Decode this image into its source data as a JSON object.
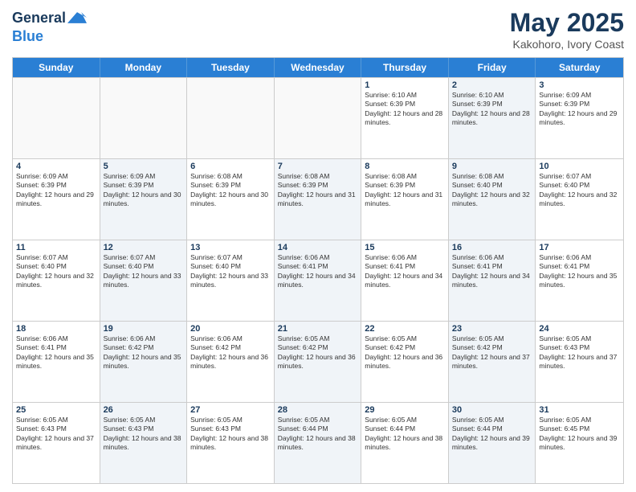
{
  "header": {
    "logo_line1": "General",
    "logo_line2": "Blue",
    "month_title": "May 2025",
    "location": "Kakohoro, Ivory Coast"
  },
  "days_of_week": [
    "Sunday",
    "Monday",
    "Tuesday",
    "Wednesday",
    "Thursday",
    "Friday",
    "Saturday"
  ],
  "rows": [
    [
      {
        "day": "",
        "text": "",
        "shaded": false,
        "empty": true
      },
      {
        "day": "",
        "text": "",
        "shaded": false,
        "empty": true
      },
      {
        "day": "",
        "text": "",
        "shaded": false,
        "empty": true
      },
      {
        "day": "",
        "text": "",
        "shaded": false,
        "empty": true
      },
      {
        "day": "1",
        "text": "Sunrise: 6:10 AM\nSunset: 6:39 PM\nDaylight: 12 hours and 28 minutes.",
        "shaded": false,
        "empty": false
      },
      {
        "day": "2",
        "text": "Sunrise: 6:10 AM\nSunset: 6:39 PM\nDaylight: 12 hours and 28 minutes.",
        "shaded": true,
        "empty": false
      },
      {
        "day": "3",
        "text": "Sunrise: 6:09 AM\nSunset: 6:39 PM\nDaylight: 12 hours and 29 minutes.",
        "shaded": false,
        "empty": false
      }
    ],
    [
      {
        "day": "4",
        "text": "Sunrise: 6:09 AM\nSunset: 6:39 PM\nDaylight: 12 hours and 29 minutes.",
        "shaded": false,
        "empty": false
      },
      {
        "day": "5",
        "text": "Sunrise: 6:09 AM\nSunset: 6:39 PM\nDaylight: 12 hours and 30 minutes.",
        "shaded": true,
        "empty": false
      },
      {
        "day": "6",
        "text": "Sunrise: 6:08 AM\nSunset: 6:39 PM\nDaylight: 12 hours and 30 minutes.",
        "shaded": false,
        "empty": false
      },
      {
        "day": "7",
        "text": "Sunrise: 6:08 AM\nSunset: 6:39 PM\nDaylight: 12 hours and 31 minutes.",
        "shaded": true,
        "empty": false
      },
      {
        "day": "8",
        "text": "Sunrise: 6:08 AM\nSunset: 6:39 PM\nDaylight: 12 hours and 31 minutes.",
        "shaded": false,
        "empty": false
      },
      {
        "day": "9",
        "text": "Sunrise: 6:08 AM\nSunset: 6:40 PM\nDaylight: 12 hours and 32 minutes.",
        "shaded": true,
        "empty": false
      },
      {
        "day": "10",
        "text": "Sunrise: 6:07 AM\nSunset: 6:40 PM\nDaylight: 12 hours and 32 minutes.",
        "shaded": false,
        "empty": false
      }
    ],
    [
      {
        "day": "11",
        "text": "Sunrise: 6:07 AM\nSunset: 6:40 PM\nDaylight: 12 hours and 32 minutes.",
        "shaded": false,
        "empty": false
      },
      {
        "day": "12",
        "text": "Sunrise: 6:07 AM\nSunset: 6:40 PM\nDaylight: 12 hours and 33 minutes.",
        "shaded": true,
        "empty": false
      },
      {
        "day": "13",
        "text": "Sunrise: 6:07 AM\nSunset: 6:40 PM\nDaylight: 12 hours and 33 minutes.",
        "shaded": false,
        "empty": false
      },
      {
        "day": "14",
        "text": "Sunrise: 6:06 AM\nSunset: 6:41 PM\nDaylight: 12 hours and 34 minutes.",
        "shaded": true,
        "empty": false
      },
      {
        "day": "15",
        "text": "Sunrise: 6:06 AM\nSunset: 6:41 PM\nDaylight: 12 hours and 34 minutes.",
        "shaded": false,
        "empty": false
      },
      {
        "day": "16",
        "text": "Sunrise: 6:06 AM\nSunset: 6:41 PM\nDaylight: 12 hours and 34 minutes.",
        "shaded": true,
        "empty": false
      },
      {
        "day": "17",
        "text": "Sunrise: 6:06 AM\nSunset: 6:41 PM\nDaylight: 12 hours and 35 minutes.",
        "shaded": false,
        "empty": false
      }
    ],
    [
      {
        "day": "18",
        "text": "Sunrise: 6:06 AM\nSunset: 6:41 PM\nDaylight: 12 hours and 35 minutes.",
        "shaded": false,
        "empty": false
      },
      {
        "day": "19",
        "text": "Sunrise: 6:06 AM\nSunset: 6:42 PM\nDaylight: 12 hours and 35 minutes.",
        "shaded": true,
        "empty": false
      },
      {
        "day": "20",
        "text": "Sunrise: 6:06 AM\nSunset: 6:42 PM\nDaylight: 12 hours and 36 minutes.",
        "shaded": false,
        "empty": false
      },
      {
        "day": "21",
        "text": "Sunrise: 6:05 AM\nSunset: 6:42 PM\nDaylight: 12 hours and 36 minutes.",
        "shaded": true,
        "empty": false
      },
      {
        "day": "22",
        "text": "Sunrise: 6:05 AM\nSunset: 6:42 PM\nDaylight: 12 hours and 36 minutes.",
        "shaded": false,
        "empty": false
      },
      {
        "day": "23",
        "text": "Sunrise: 6:05 AM\nSunset: 6:42 PM\nDaylight: 12 hours and 37 minutes.",
        "shaded": true,
        "empty": false
      },
      {
        "day": "24",
        "text": "Sunrise: 6:05 AM\nSunset: 6:43 PM\nDaylight: 12 hours and 37 minutes.",
        "shaded": false,
        "empty": false
      }
    ],
    [
      {
        "day": "25",
        "text": "Sunrise: 6:05 AM\nSunset: 6:43 PM\nDaylight: 12 hours and 37 minutes.",
        "shaded": false,
        "empty": false
      },
      {
        "day": "26",
        "text": "Sunrise: 6:05 AM\nSunset: 6:43 PM\nDaylight: 12 hours and 38 minutes.",
        "shaded": true,
        "empty": false
      },
      {
        "day": "27",
        "text": "Sunrise: 6:05 AM\nSunset: 6:43 PM\nDaylight: 12 hours and 38 minutes.",
        "shaded": false,
        "empty": false
      },
      {
        "day": "28",
        "text": "Sunrise: 6:05 AM\nSunset: 6:44 PM\nDaylight: 12 hours and 38 minutes.",
        "shaded": true,
        "empty": false
      },
      {
        "day": "29",
        "text": "Sunrise: 6:05 AM\nSunset: 6:44 PM\nDaylight: 12 hours and 38 minutes.",
        "shaded": false,
        "empty": false
      },
      {
        "day": "30",
        "text": "Sunrise: 6:05 AM\nSunset: 6:44 PM\nDaylight: 12 hours and 39 minutes.",
        "shaded": true,
        "empty": false
      },
      {
        "day": "31",
        "text": "Sunrise: 6:05 AM\nSunset: 6:45 PM\nDaylight: 12 hours and 39 minutes.",
        "shaded": false,
        "empty": false
      }
    ]
  ]
}
